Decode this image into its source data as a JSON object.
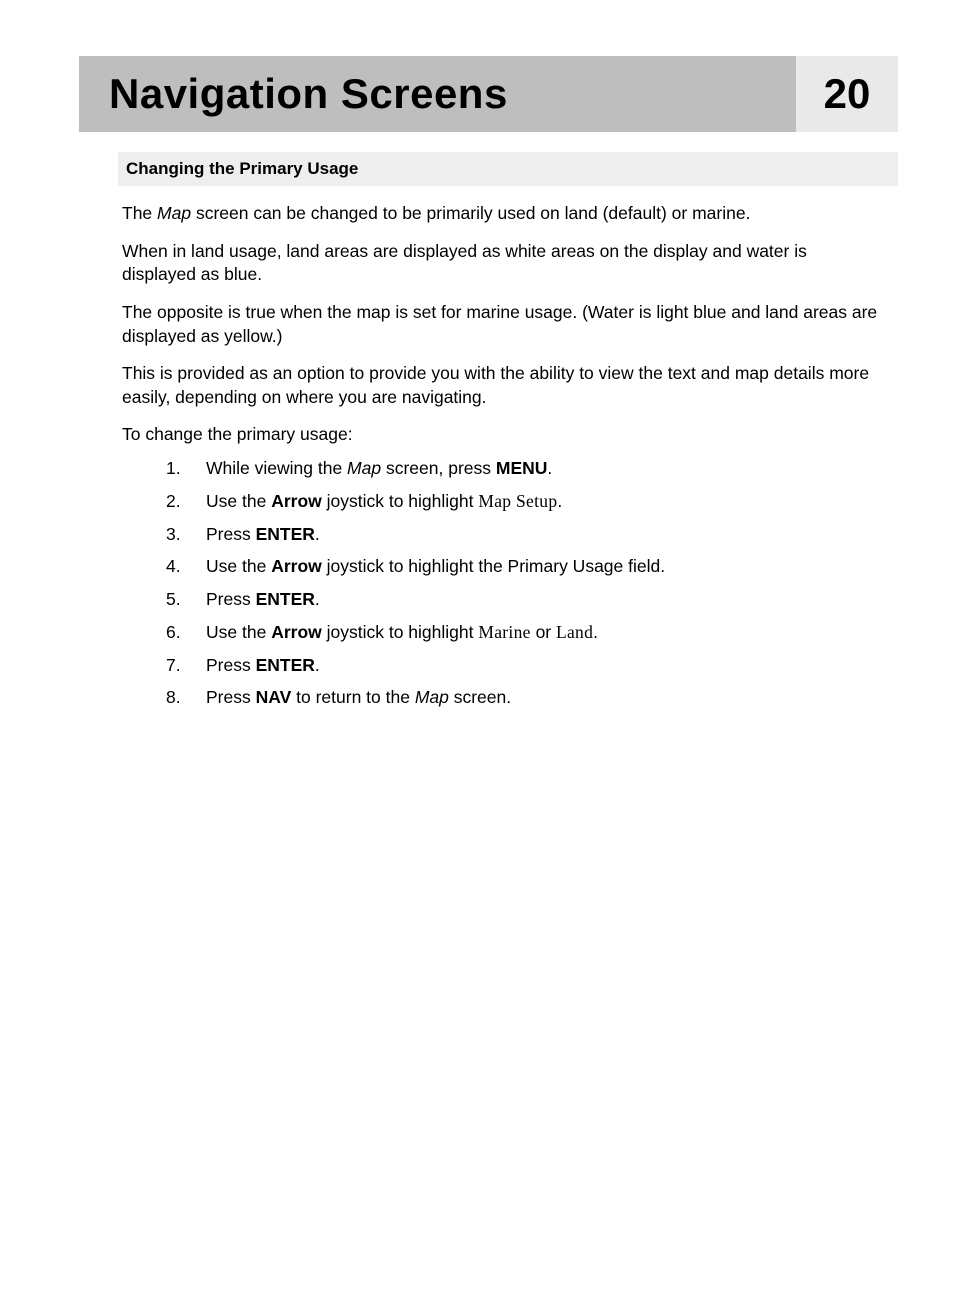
{
  "header": {
    "title": "Navigation Screens",
    "page_number": "20"
  },
  "section": {
    "heading": "Changing the Primary Usage",
    "intro_map_word": "Map",
    "intro_rest": " screen can be changed to be primarily used on land (default) or marine.",
    "intro_prefix": "The ",
    "para2": "When in land usage, land areas are displayed as white areas on the display and water is displayed as blue.",
    "para3": "The opposite is true when the map is set for marine usage. (Water is light blue and land areas are displayed as yellow.)",
    "para4": "This is provided as an option to provide you with the ability to view the text and map details more easily, depending on where you are navigating.",
    "lead": "To  change the primary usage:",
    "steps": [
      {
        "num": "1.",
        "pre": "While viewing the ",
        "italic1": "Map",
        "mid1": " screen, press ",
        "bold1": "MENU",
        "post": "."
      },
      {
        "num": "2.",
        "pre": "Use the ",
        "bold1": "Arrow",
        "mid1": " joystick to highlight ",
        "serif1": "Map Setup",
        "post": "."
      },
      {
        "num": "3.",
        "pre": "Press ",
        "bold1": "ENTER",
        "post": "."
      },
      {
        "num": "4.",
        "pre": "Use the ",
        "bold1": "Arrow",
        "mid1": " joystick to highlight the Primary Usage field.",
        "post": ""
      },
      {
        "num": "5.",
        "pre": "Press ",
        "bold1": "ENTER",
        "post": "."
      },
      {
        "num": "6.",
        "pre": "Use the ",
        "bold1": "Arrow",
        "mid1": " joystick to highlight ",
        "serif1": "Marine",
        "mid2": " or ",
        "serif2": "Land",
        "post": "."
      },
      {
        "num": "7.",
        "pre": "Press ",
        "bold1": "ENTER",
        "post": "."
      },
      {
        "num": "8.",
        "pre": "Press ",
        "bold1": "NAV",
        "mid1": " to return to the ",
        "italic1": "Map",
        "mid2": " screen.",
        "post": ""
      }
    ]
  }
}
